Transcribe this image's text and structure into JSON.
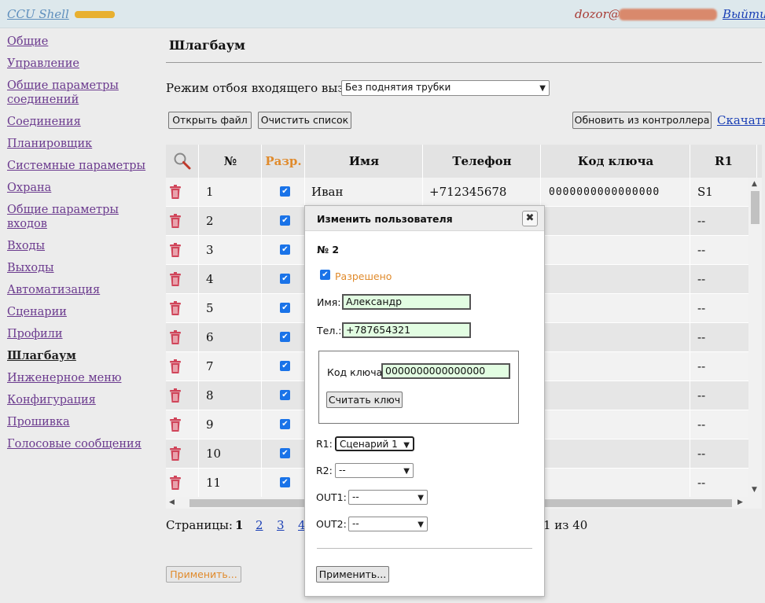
{
  "header": {
    "app_title": "CCU Shell",
    "user": "dozor@",
    "logout": "Выйти"
  },
  "sidebar": {
    "items": [
      {
        "label": "Общие"
      },
      {
        "label": "Управление"
      },
      {
        "label": "Общие параметры соединений"
      },
      {
        "label": "Соединения"
      },
      {
        "label": "Планировщик"
      },
      {
        "label": "Системные параметры"
      },
      {
        "label": "Охрана"
      },
      {
        "label": "Общие параметры входов"
      },
      {
        "label": "Входы"
      },
      {
        "label": "Выходы"
      },
      {
        "label": "Автоматизация"
      },
      {
        "label": "Сценарии"
      },
      {
        "label": "Профили"
      },
      {
        "label": "Шлагбаум",
        "active": true
      },
      {
        "label": "Инженерное меню"
      },
      {
        "label": "Конфигурация"
      },
      {
        "label": "Прошивка"
      },
      {
        "label": "Голосовые сообщения"
      }
    ]
  },
  "main": {
    "title": "Шлагбаум",
    "mode_label": "Режим отбоя входящего вызова:",
    "mode_value": "Без поднятия трубки",
    "open_file": "Открыть файл",
    "clear_list": "Очистить список",
    "refresh": "Обновить из контроллера",
    "download": "Скачать",
    "apply": "Применить..."
  },
  "table": {
    "columns": [
      "№",
      "Разр.",
      "Имя",
      "Телефон",
      "Код ключа",
      "R1"
    ],
    "rows": [
      {
        "num": "1",
        "name": "Иван",
        "phone": "+712345678",
        "key": "0000000000000000",
        "r1": "S1"
      },
      {
        "num": "2",
        "name": "",
        "phone": "",
        "key": "",
        "r1": "--"
      },
      {
        "num": "3",
        "name": "",
        "phone": "",
        "key": "",
        "r1": "--"
      },
      {
        "num": "4",
        "name": "",
        "phone": "",
        "key": "",
        "r1": "--"
      },
      {
        "num": "5",
        "name": "",
        "phone": "",
        "key": "",
        "r1": "--"
      },
      {
        "num": "6",
        "name": "",
        "phone": "",
        "key": "",
        "r1": "--"
      },
      {
        "num": "7",
        "name": "",
        "phone": "",
        "key": "",
        "r1": "--"
      },
      {
        "num": "8",
        "name": "",
        "phone": "",
        "key": "",
        "r1": "--"
      },
      {
        "num": "9",
        "name": "",
        "phone": "",
        "key": "",
        "r1": "--"
      },
      {
        "num": "10",
        "name": "",
        "phone": "",
        "key": "",
        "r1": "--"
      },
      {
        "num": "11",
        "name": "",
        "phone": "",
        "key": "",
        "r1": "--"
      }
    ]
  },
  "pagination": {
    "label": "Страницы:",
    "pages": [
      "1",
      "2",
      "3",
      "4"
    ],
    "status": "1 из 40"
  },
  "dialog": {
    "title": "Изменить пользователя",
    "number": "№ 2",
    "allowed_label": "Разрешено",
    "name_label": "Имя:",
    "name_value": "Александр",
    "phone_label": "Тел.:",
    "phone_value": "+787654321",
    "key_label": "Код ключа:",
    "key_value": "0000000000000000",
    "read_key": "Считать ключ",
    "r1_label": "R1:",
    "r1_value": "Сценарий 1",
    "r2_label": "R2:",
    "r2_value": "--",
    "out1_label": "OUT1:",
    "out1_value": "--",
    "out2_label": "OUT2:",
    "out2_value": "--",
    "apply": "Применить..."
  },
  "colors": {
    "accent_orange": "#e08a2b",
    "link_blue": "#1a3fb5",
    "nav_purple": "#6b3a8e",
    "input_green": "#e2fde2",
    "trash_red": "#d0455a"
  }
}
